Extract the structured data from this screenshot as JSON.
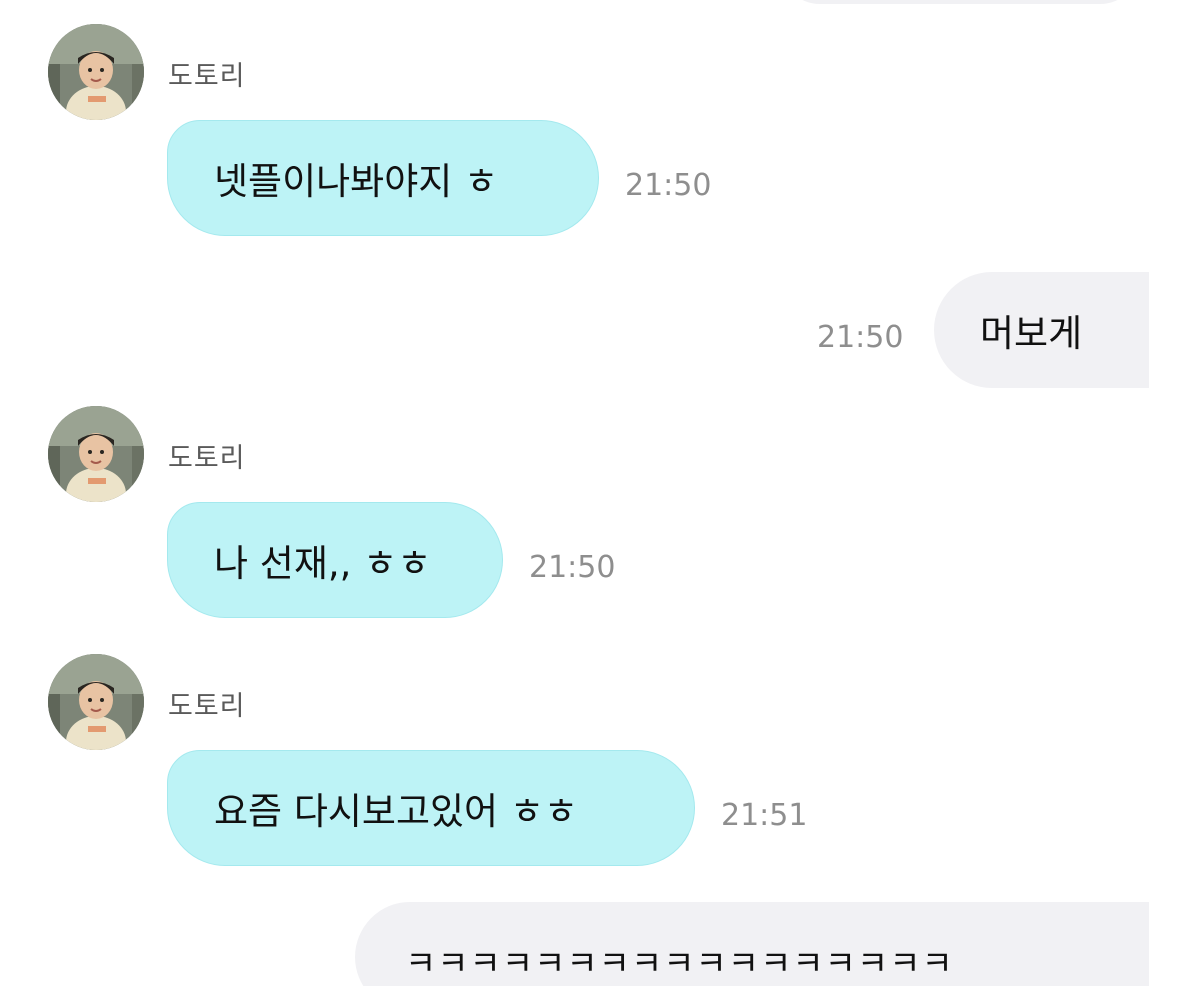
{
  "contact": {
    "name": "도토리",
    "avatar_icon": "profile-photo-child"
  },
  "colors": {
    "incoming_bubble": "#bdf3f6",
    "outgoing_bubble": "#f1f1f4",
    "timestamp": "#8e8e8e"
  },
  "messages": [
    {
      "direction": "in",
      "sender": "도토리",
      "text": "넷플이나봐야지 ㅎ",
      "time": "21:50"
    },
    {
      "direction": "out",
      "text": "머보게",
      "time": "21:50"
    },
    {
      "direction": "in",
      "sender": "도토리",
      "text": "나 선재,, ㅎㅎ",
      "time": "21:50"
    },
    {
      "direction": "in",
      "sender": "도토리",
      "text": "요즘 다시보고있어 ㅎㅎ",
      "time": "21:51"
    },
    {
      "direction": "out",
      "text": "ㅋㅋㅋㅋㅋㅋㅋㅋㅋㅋㅋㅋㅋㅋㅋㅋㅋ",
      "time": ""
    }
  ]
}
